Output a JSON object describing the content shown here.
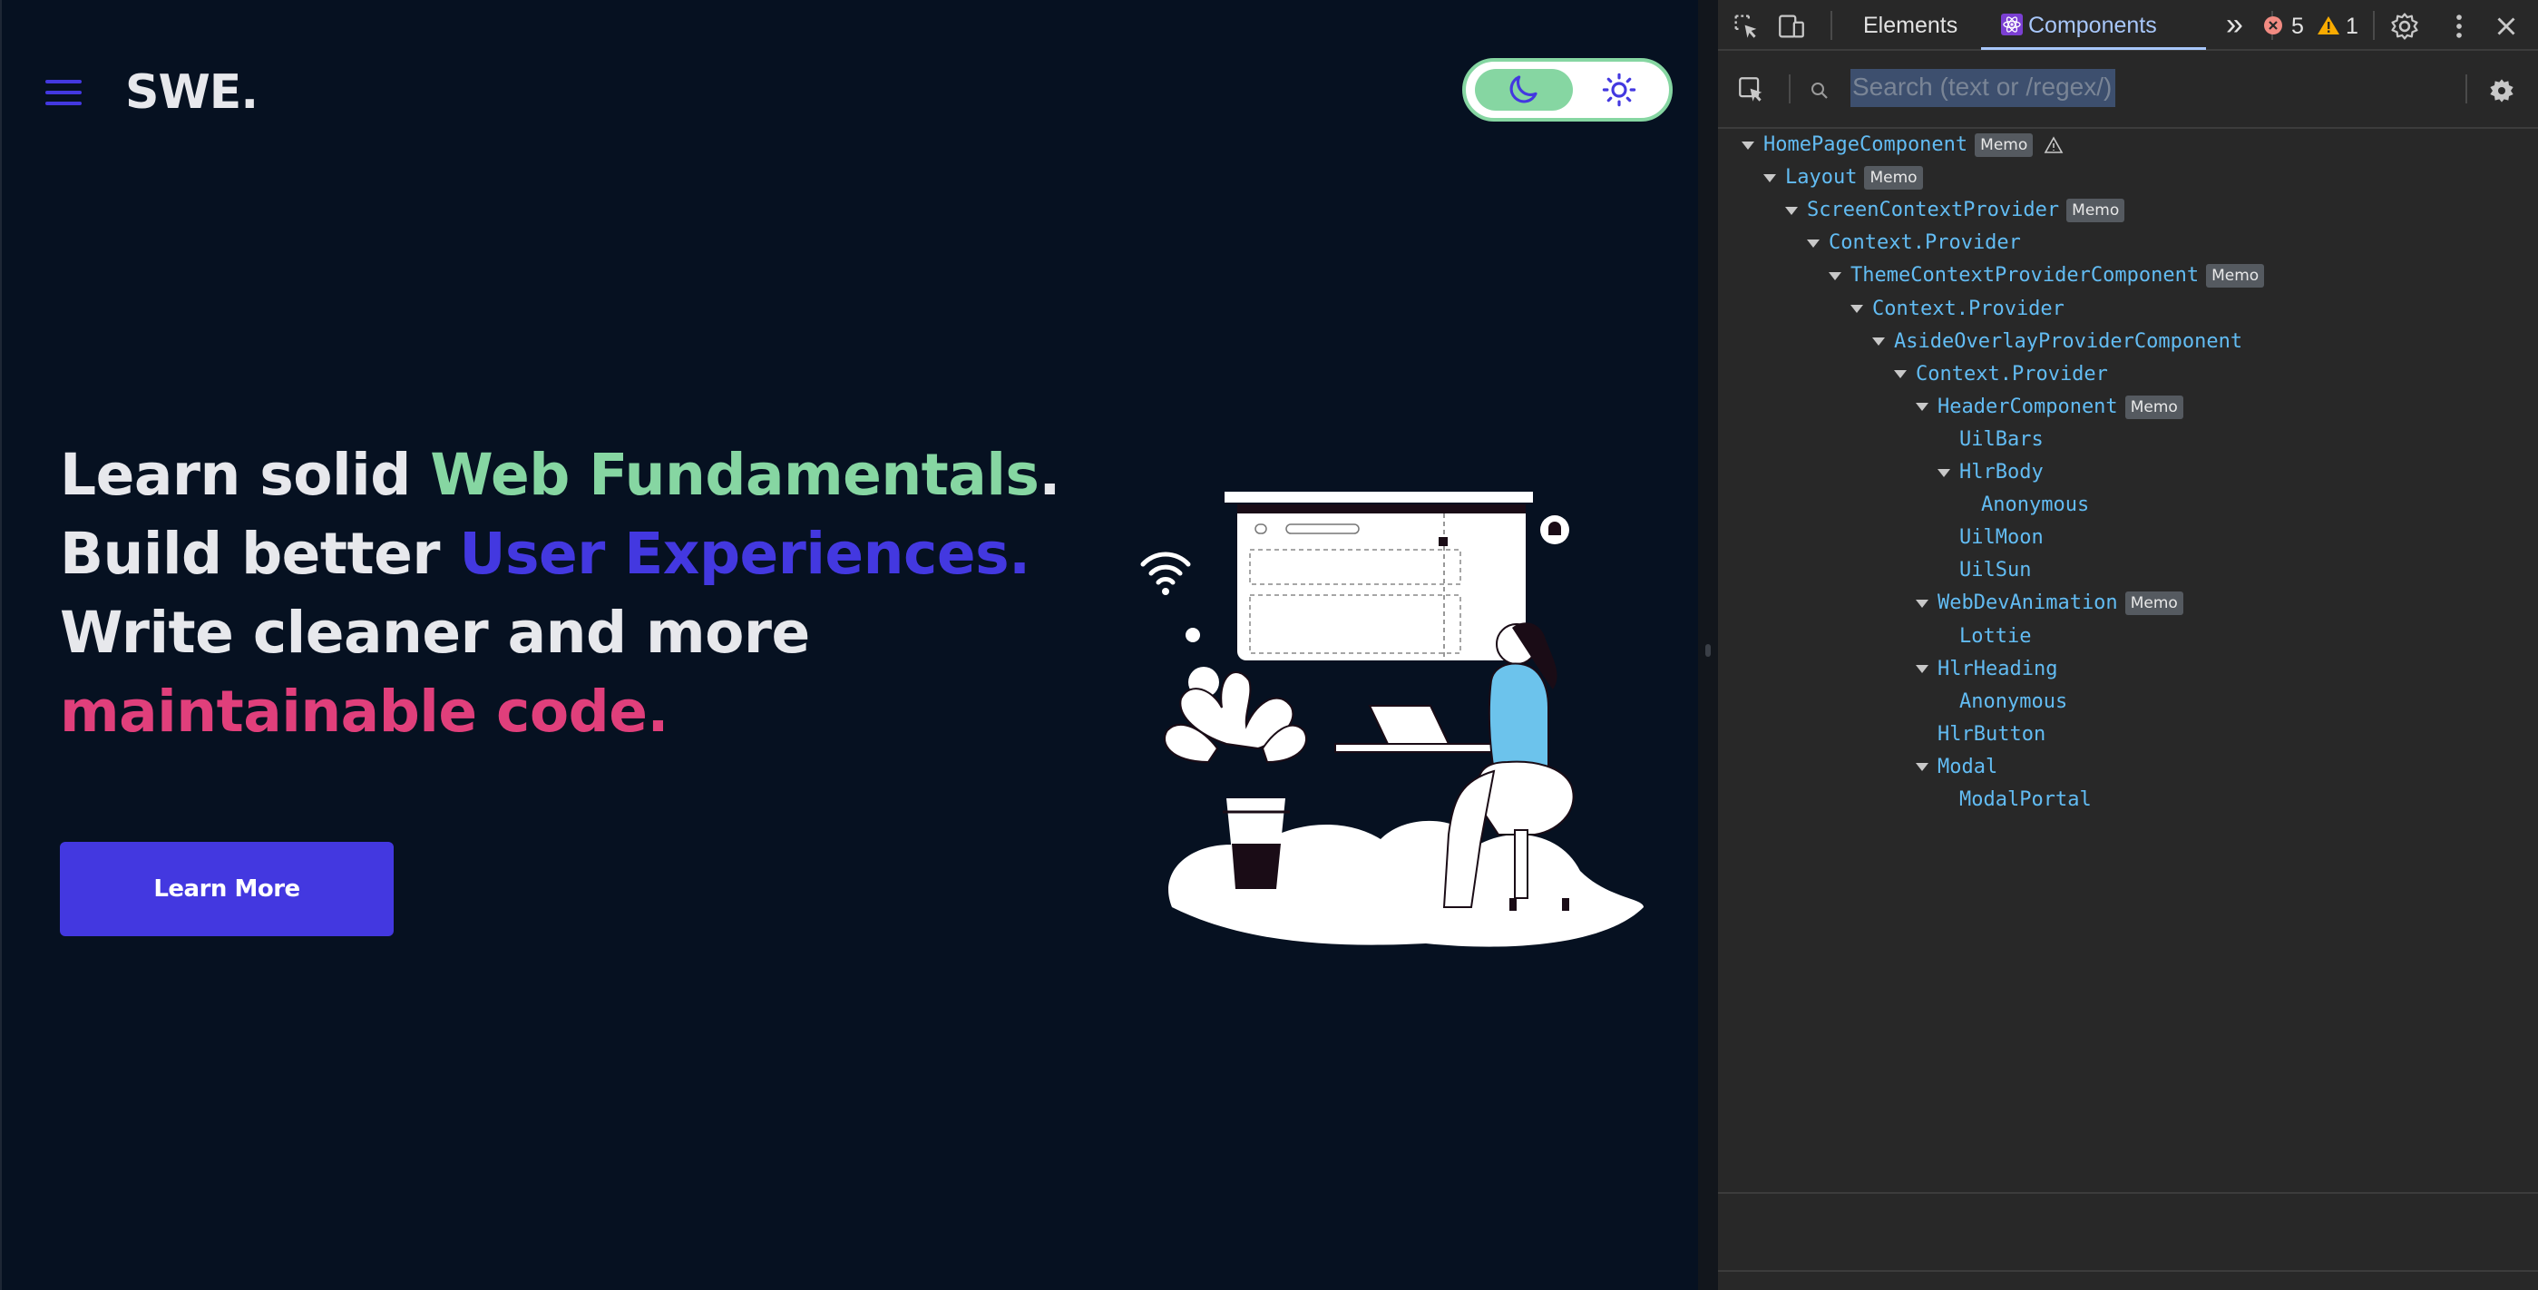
{
  "header": {
    "logo_text": "SWE",
    "logo_dot": ".",
    "menu_icon": "hamburger-menu-icon",
    "theme_toggle": {
      "dark_icon": "moon-icon",
      "light_icon": "sun-icon",
      "active": "dark"
    }
  },
  "hero": {
    "line1_a": "Learn solid ",
    "line1_b": "Web Fundamentals",
    "line1_c": ".",
    "line2_a": "Build better ",
    "line2_b": "User Experiences.",
    "line3": "Write cleaner and more",
    "line4": "maintainable code.",
    "button_label": "Learn More"
  },
  "colors": {
    "background": "#061121",
    "green": "#86d6a2",
    "blue": "#4338e0",
    "pink": "#e03f7b",
    "text": "#e7e8ec"
  },
  "devtools": {
    "tabs": {
      "elements": "Elements",
      "components": "Components",
      "more": "»"
    },
    "active_tab": "Components",
    "error_count": "5",
    "warning_count": "1",
    "search_placeholder": "Search (text or /regex/)",
    "tree": [
      {
        "label": "HomePageComponent",
        "depth": 0,
        "expanded": true,
        "memo": "Memo",
        "warning": true
      },
      {
        "label": "Layout",
        "depth": 1,
        "expanded": true,
        "memo": "Memo"
      },
      {
        "label": "ScreenContextProvider",
        "depth": 2,
        "expanded": true,
        "memo": "Memo"
      },
      {
        "label": "Context.Provider",
        "depth": 3,
        "expanded": true
      },
      {
        "label": "ThemeContextProviderComponent",
        "depth": 4,
        "expanded": true,
        "memo": "Memo"
      },
      {
        "label": "Context.Provider",
        "depth": 5,
        "expanded": true
      },
      {
        "label": "AsideOverlayProviderComponent",
        "depth": 6,
        "expanded": true
      },
      {
        "label": "Context.Provider",
        "depth": 7,
        "expanded": true
      },
      {
        "label": "HeaderComponent",
        "depth": 8,
        "expanded": true,
        "memo": "Memo"
      },
      {
        "label": "UilBars",
        "depth": 9,
        "expanded": false
      },
      {
        "label": "HlrBody",
        "depth": 9,
        "expanded": true
      },
      {
        "label": "Anonymous",
        "depth": 10,
        "expanded": false
      },
      {
        "label": "UilMoon",
        "depth": 9,
        "expanded": false
      },
      {
        "label": "UilSun",
        "depth": 9,
        "expanded": false
      },
      {
        "label": "WebDevAnimation",
        "depth": 8,
        "expanded": true,
        "memo": "Memo"
      },
      {
        "label": "Lottie",
        "depth": 9,
        "expanded": false
      },
      {
        "label": "HlrHeading",
        "depth": 8,
        "expanded": true
      },
      {
        "label": "Anonymous",
        "depth": 9,
        "expanded": false
      },
      {
        "label": "HlrButton",
        "depth": 8,
        "expanded": false
      },
      {
        "label": "Modal",
        "depth": 8,
        "expanded": true
      },
      {
        "label": "ModalPortal",
        "depth": 9,
        "expanded": false
      }
    ]
  }
}
